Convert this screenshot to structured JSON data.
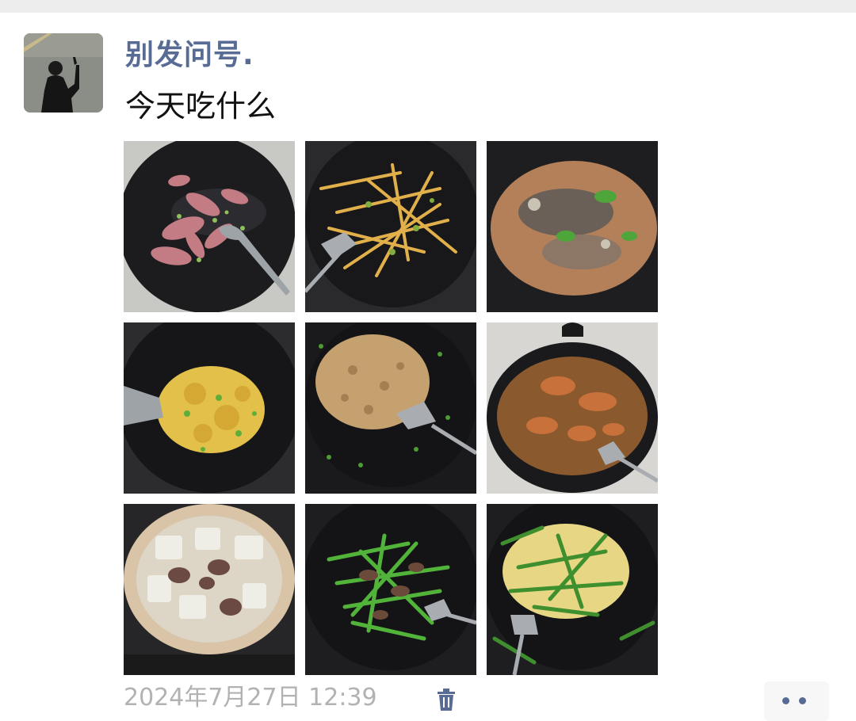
{
  "post": {
    "username": "别发问号.",
    "text": "今天吃什么",
    "timestamp": "2024年7月27日 12:39",
    "photos": [
      {
        "icon": "dish-photo-stir-fried-pork"
      },
      {
        "icon": "dish-photo-shredded-potato"
      },
      {
        "icon": "dish-photo-braised-fish"
      },
      {
        "icon": "dish-photo-scrambled-egg"
      },
      {
        "icon": "dish-photo-minced-pork"
      },
      {
        "icon": "dish-photo-braised-chicken"
      },
      {
        "icon": "dish-photo-radish-beef-soup"
      },
      {
        "icon": "dish-photo-chive-beef"
      },
      {
        "icon": "dish-photo-chive-egg"
      }
    ]
  },
  "icons": {
    "avatar": "avatar-silhouette",
    "delete": "trash-icon",
    "more": "more-dots-icon"
  },
  "colors": {
    "username": "#576b95",
    "timestamp": "#b2b2b2",
    "text": "#111111"
  }
}
